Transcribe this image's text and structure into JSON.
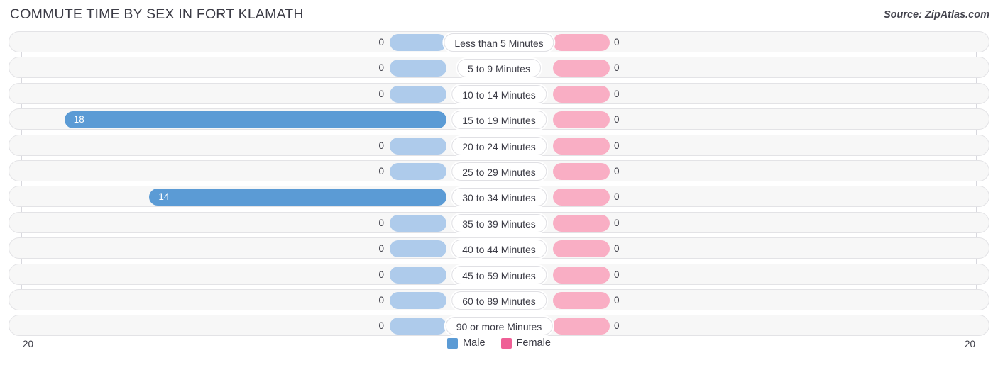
{
  "header": {
    "title": "COMMUTE TIME BY SEX IN FORT KLAMATH",
    "source": "Source: ZipAtlas.com"
  },
  "legend": {
    "items": [
      {
        "label": "Male",
        "color": "#5b9bd5"
      },
      {
        "label": "Female",
        "color": "#ef5f96"
      }
    ]
  },
  "axis": {
    "left_max_label": "20",
    "right_max_label": "20",
    "max": 20
  },
  "colors": {
    "male_active": "#5b9bd5",
    "male_zero": "#aecbeb",
    "female_active": "#ef5f96",
    "female_zero": "#f9aec4",
    "track": "#f7f7f7",
    "track_border": "#e3e3e6",
    "title_text": "#3c3c46"
  },
  "chart_data": {
    "type": "bar",
    "title": "COMMUTE TIME BY SEX IN FORT KLAMATH",
    "subtitle": "",
    "xlabel": "",
    "ylabel": "",
    "orientation": "horizontal",
    "style": "diverging-bidirectional",
    "xlim": [
      20,
      20
    ],
    "grid": false,
    "legend_position": "bottom-center",
    "categories": [
      "Less than 5 Minutes",
      "5 to 9 Minutes",
      "10 to 14 Minutes",
      "15 to 19 Minutes",
      "20 to 24 Minutes",
      "25 to 29 Minutes",
      "30 to 34 Minutes",
      "35 to 39 Minutes",
      "40 to 44 Minutes",
      "45 to 59 Minutes",
      "60 to 89 Minutes",
      "90 or more Minutes"
    ],
    "series": [
      {
        "name": "Male",
        "side": "left",
        "values": [
          0,
          0,
          0,
          18,
          0,
          0,
          14,
          0,
          0,
          0,
          0,
          0
        ],
        "labels": [
          "0",
          "0",
          "0",
          "18",
          "0",
          "0",
          "14",
          "0",
          "0",
          "0",
          "0",
          "0"
        ]
      },
      {
        "name": "Female",
        "side": "right",
        "values": [
          0,
          0,
          0,
          0,
          0,
          0,
          0,
          0,
          0,
          0,
          0,
          0
        ],
        "labels": [
          "0",
          "0",
          "0",
          "0",
          "0",
          "0",
          "0",
          "0",
          "0",
          "0",
          "0",
          "0"
        ]
      }
    ]
  }
}
